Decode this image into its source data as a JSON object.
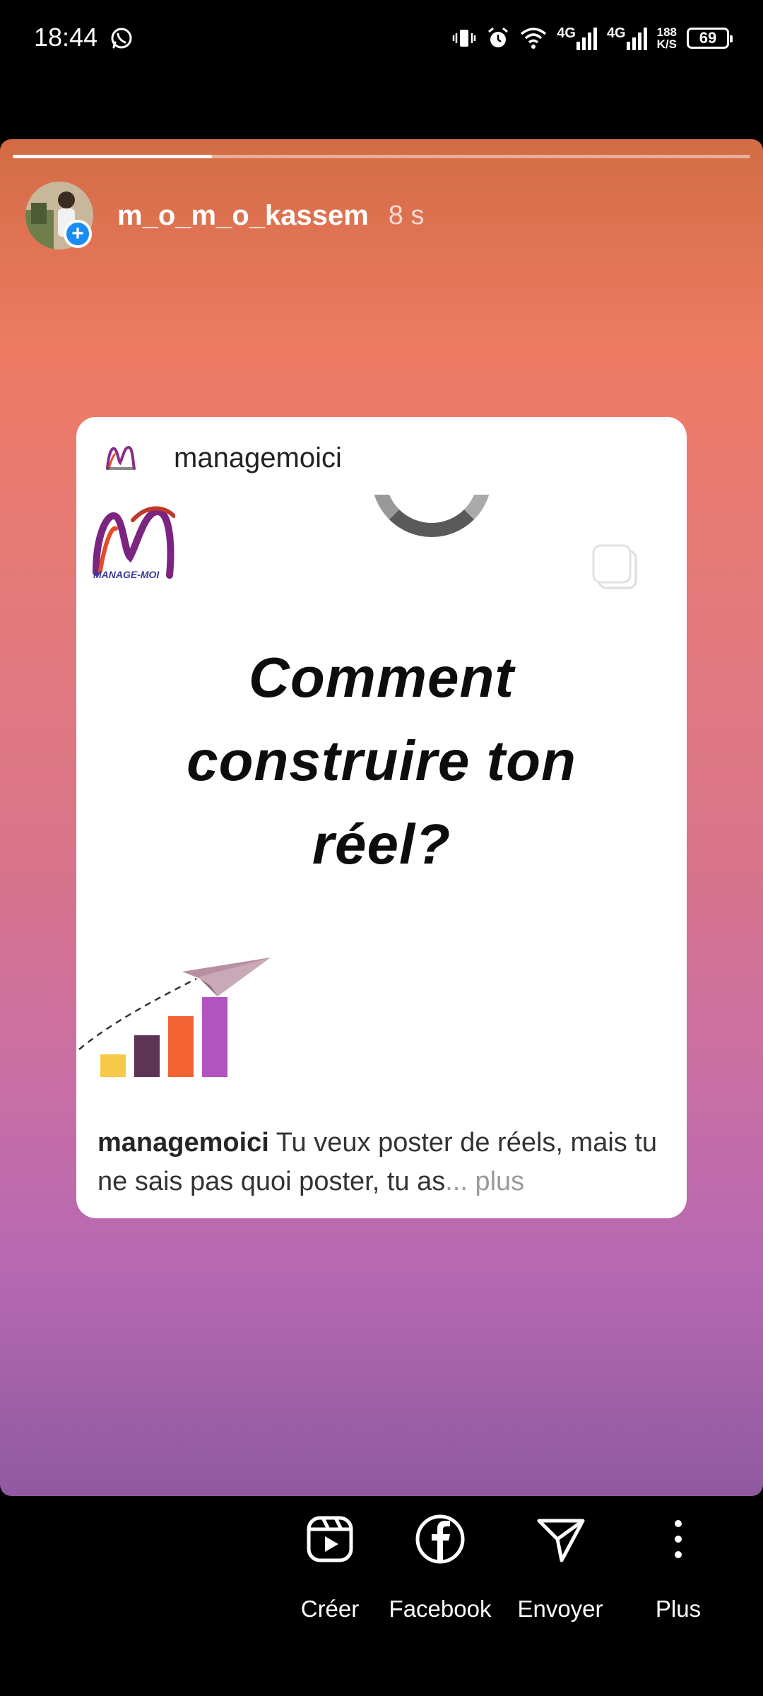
{
  "status_bar": {
    "time": "18:44",
    "net1": "4G",
    "net2": "4G",
    "speed_value": "188",
    "speed_unit": "K/S",
    "battery": "69"
  },
  "story": {
    "progress": 0.27,
    "username": "m_o_m_o_kassem",
    "time_ago": "8 s"
  },
  "post": {
    "account": "managemoici",
    "logo_text": "MANAGE-MOI",
    "title_lines": [
      "Comment",
      "construire ton",
      "réel?"
    ],
    "caption_user": "managemoici",
    "caption_text": " Tu veux poster de réels, mais tu ne sais pas quoi poster, tu as",
    "caption_more": "... plus"
  },
  "actions": {
    "create": "Créer",
    "facebook": "Facebook",
    "send": "Envoyer",
    "more": "Plus"
  },
  "colors": {
    "accent_blue": "#1a8cf3",
    "bar_yellow": "#f7c948",
    "bar_plum": "#5b3456",
    "bar_orange": "#f26232",
    "bar_purple": "#b154c0"
  }
}
